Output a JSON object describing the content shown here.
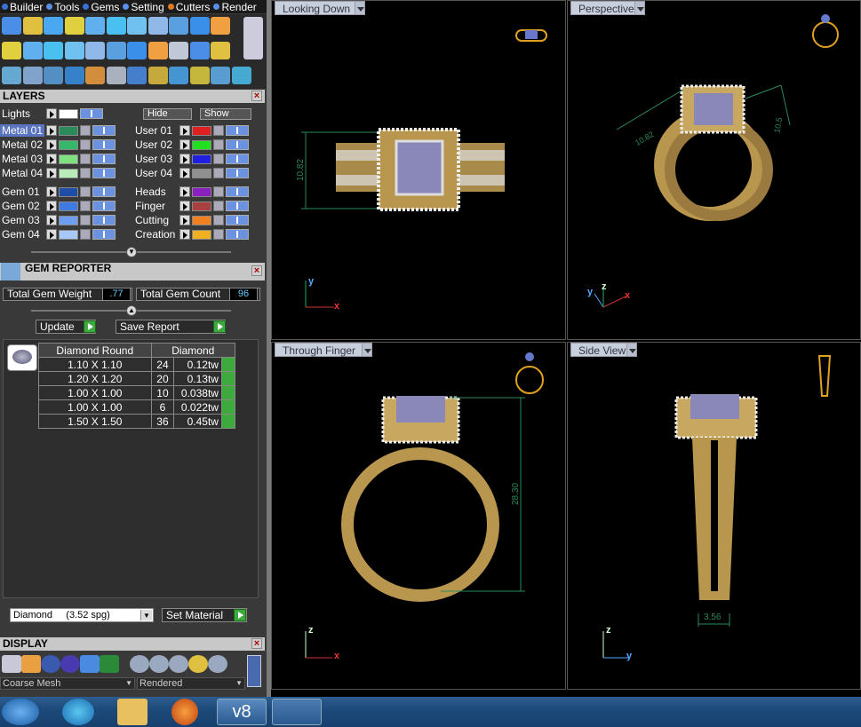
{
  "menu": {
    "items": [
      {
        "label": "Builder",
        "color": "#3a6fd8"
      },
      {
        "label": "Tools",
        "color": "#5a8ee8"
      },
      {
        "label": "Gems",
        "color": "#3a6fd8"
      },
      {
        "label": "Setting",
        "color": "#5a8ee8"
      },
      {
        "label": "Cutters",
        "color": "#e07a20"
      },
      {
        "label": "Render",
        "color": "#5a8ee8"
      }
    ]
  },
  "layers": {
    "title": "LAYERS",
    "lights": {
      "label": "Lights",
      "hide": "Hide",
      "show": "Show"
    },
    "left": [
      {
        "name": "Metal 01",
        "color": "#2a8a5a",
        "selected": true
      },
      {
        "name": "Metal 02",
        "color": "#35b86a"
      },
      {
        "name": "Metal 03",
        "color": "#7ee07e"
      },
      {
        "name": "Metal 04",
        "color": "#b8ecb8"
      },
      {
        "name": "Gem 01",
        "color": "#1f4ea8"
      },
      {
        "name": "Gem 02",
        "color": "#3f7ae0"
      },
      {
        "name": "Gem 03",
        "color": "#6f9ef0"
      },
      {
        "name": "Gem 04",
        "color": "#a8c8f8"
      }
    ],
    "right": [
      {
        "name": "User 01",
        "color": "#e02020"
      },
      {
        "name": "User 02",
        "color": "#20e020"
      },
      {
        "name": "User 03",
        "color": "#2020e0"
      },
      {
        "name": "User 04",
        "color": "#909090"
      },
      {
        "name": "Heads",
        "color": "#8a20c0"
      },
      {
        "name": "Finger",
        "color": "#a84040"
      },
      {
        "name": "Cutting",
        "color": "#f08020"
      },
      {
        "name": "Creation",
        "color": "#f0b020"
      }
    ]
  },
  "gem_reporter": {
    "title": "GEM REPORTER",
    "total_weight_label": "Total Gem Weight",
    "total_weight": ".77",
    "total_count_label": "Total Gem Count",
    "total_count": "96",
    "update_label": "Update",
    "save_label": "Save Report",
    "table": {
      "headers": [
        "Diamond Round",
        "Diamond"
      ],
      "rows": [
        {
          "size": "1.10 X 1.10",
          "count": "24",
          "weight": "0.12tw"
        },
        {
          "size": "1.20 X 1.20",
          "count": "20",
          "weight": "0.13tw"
        },
        {
          "size": "1.00 X 1.00",
          "count": "10",
          "weight": "0.038tw"
        },
        {
          "size": "1.00 X 1.00",
          "count": "6",
          "weight": "0.022tw"
        },
        {
          "size": "1.50 X 1.50",
          "count": "36",
          "weight": "0.45tw"
        }
      ]
    },
    "material": "Diamond     (3.52 spg)",
    "set_material": "Set Material"
  },
  "display": {
    "title": "DISPLAY",
    "mesh": "Coarse Mesh",
    "render": "Rendered"
  },
  "viewports": {
    "top_left": {
      "label": "Looking Down",
      "dim": "10.82",
      "axis1": "y",
      "axis2": "x"
    },
    "top_right": {
      "label": "Perspective",
      "dim1": "10.82",
      "dim2": "10.5",
      "axis1": "y",
      "axis2": "z",
      "axis3": "x"
    },
    "bottom_left": {
      "label": "Through Finger",
      "dim": "28.30",
      "axis1": "z",
      "axis2": "x"
    },
    "bottom_right": {
      "label": "Side View",
      "dim": "3.56",
      "axis1": "z",
      "axis2": "y"
    }
  },
  "taskbar": {
    "app_label": "v8"
  }
}
